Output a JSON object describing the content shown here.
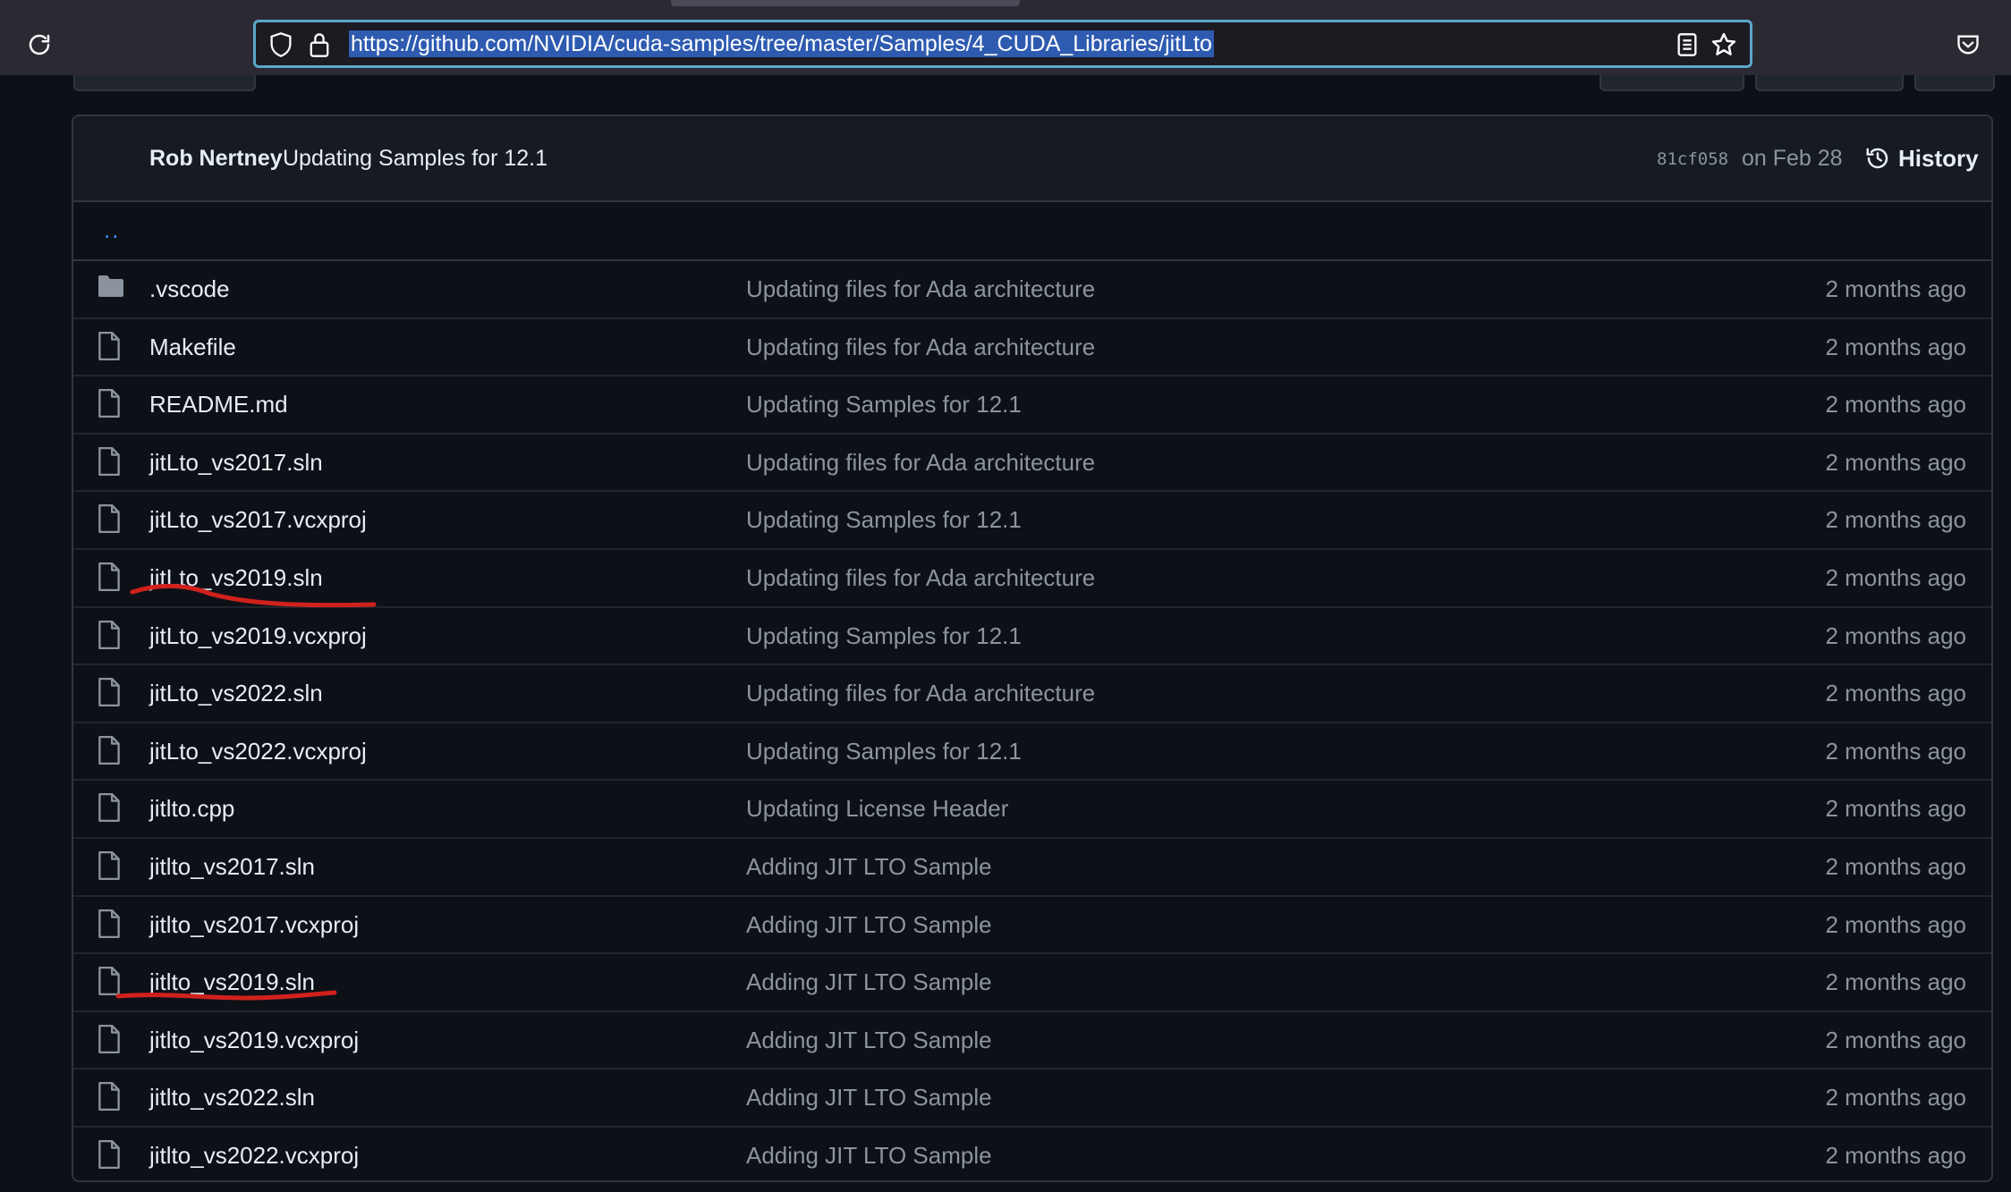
{
  "browser": {
    "url": "https://github.com/NVIDIA/cuda-samples/tree/master/Samples/4_CUDA_Libraries/jitLto"
  },
  "commit": {
    "author": "Rob Nertney",
    "message": "Updating Samples for 12.1",
    "sha": "81cf058",
    "date": "on Feb 28",
    "history_label": "History"
  },
  "parent_link": "..",
  "files": [
    {
      "name": ".vscode",
      "type": "folder",
      "message": "Updating files for Ada architecture",
      "age": "2 months ago"
    },
    {
      "name": "Makefile",
      "type": "file",
      "message": "Updating files for Ada architecture",
      "age": "2 months ago"
    },
    {
      "name": "README.md",
      "type": "file",
      "message": "Updating Samples for 12.1",
      "age": "2 months ago"
    },
    {
      "name": "jitLto_vs2017.sln",
      "type": "file",
      "message": "Updating files for Ada architecture",
      "age": "2 months ago"
    },
    {
      "name": "jitLto_vs2017.vcxproj",
      "type": "file",
      "message": "Updating Samples for 12.1",
      "age": "2 months ago"
    },
    {
      "name": "jitLto_vs2019.sln",
      "type": "file",
      "message": "Updating files for Ada architecture",
      "age": "2 months ago"
    },
    {
      "name": "jitLto_vs2019.vcxproj",
      "type": "file",
      "message": "Updating Samples for 12.1",
      "age": "2 months ago"
    },
    {
      "name": "jitLto_vs2022.sln",
      "type": "file",
      "message": "Updating files for Ada architecture",
      "age": "2 months ago"
    },
    {
      "name": "jitLto_vs2022.vcxproj",
      "type": "file",
      "message": "Updating Samples for 12.1",
      "age": "2 months ago"
    },
    {
      "name": "jitlto.cpp",
      "type": "file",
      "message": "Updating License Header",
      "age": "2 months ago"
    },
    {
      "name": "jitlto_vs2017.sln",
      "type": "file",
      "message": "Adding JIT LTO Sample",
      "age": "2 months ago"
    },
    {
      "name": "jitlto_vs2017.vcxproj",
      "type": "file",
      "message": "Adding JIT LTO Sample",
      "age": "2 months ago"
    },
    {
      "name": "jitlto_vs2019.sln",
      "type": "file",
      "message": "Adding JIT LTO Sample",
      "age": "2 months ago"
    },
    {
      "name": "jitlto_vs2019.vcxproj",
      "type": "file",
      "message": "Adding JIT LTO Sample",
      "age": "2 months ago"
    },
    {
      "name": "jitlto_vs2022.sln",
      "type": "file",
      "message": "Adding JIT LTO Sample",
      "age": "2 months ago"
    },
    {
      "name": "jitlto_vs2022.vcxproj",
      "type": "file",
      "message": "Adding JIT LTO Sample",
      "age": "2 months ago"
    }
  ],
  "colors": {
    "annotation": "#d0211c"
  },
  "icons": {
    "reload": "reload-icon",
    "shield": "shield-icon",
    "lock": "lock-icon",
    "reader": "reader-view-icon",
    "star": "star-icon",
    "pocket": "pocket-icon",
    "history": "history-icon",
    "folder": "folder-icon",
    "file": "file-icon"
  }
}
